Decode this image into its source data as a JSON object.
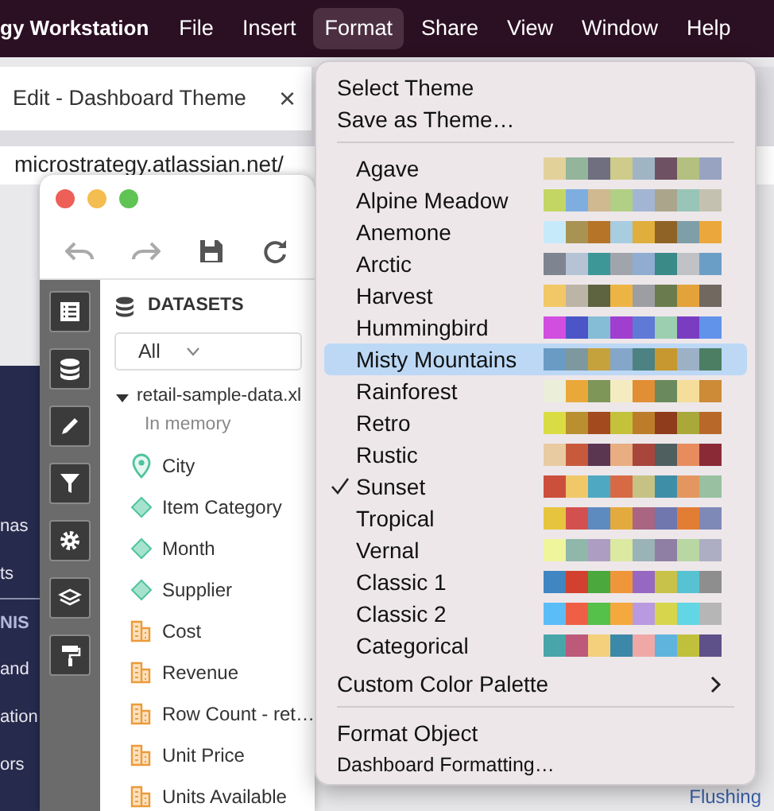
{
  "menubar": {
    "app_name": "gy Workstation",
    "items": [
      {
        "label": "File",
        "selected": false
      },
      {
        "label": "Insert",
        "selected": false
      },
      {
        "label": "Format",
        "selected": true
      },
      {
        "label": "Share",
        "selected": false
      },
      {
        "label": "View",
        "selected": false
      },
      {
        "label": "Window",
        "selected": false
      },
      {
        "label": "Help",
        "selected": false
      }
    ]
  },
  "browser": {
    "tab_title": "Edit - Dashboard Theme",
    "tab_close": "×",
    "url": "microstrategy.atlassian.net/",
    "side_fragments": [
      "nas",
      "ts",
      "NIS",
      "and",
      "ation",
      "ors"
    ],
    "corner_text": "Flushing"
  },
  "editor": {
    "datasets_title": "DATASETS",
    "filter": "All",
    "dataset": {
      "name": "retail-sample-data.xl",
      "expanded": true,
      "status": "In memory",
      "fields": [
        {
          "label": "City",
          "kind": "geo"
        },
        {
          "label": "Item Category",
          "kind": "attribute"
        },
        {
          "label": "Month",
          "kind": "attribute"
        },
        {
          "label": "Supplier",
          "kind": "attribute"
        },
        {
          "label": "Cost",
          "kind": "metric"
        },
        {
          "label": "Revenue",
          "kind": "metric"
        },
        {
          "label": "Row Count - ret…",
          "kind": "metric"
        },
        {
          "label": "Unit Price",
          "kind": "metric"
        },
        {
          "label": "Units Available",
          "kind": "metric"
        }
      ]
    }
  },
  "format_menu": {
    "top_items": [
      "Select Theme",
      "Save as Theme…"
    ],
    "themes": [
      {
        "label": "Agave",
        "checked": false,
        "selected": false,
        "swatches": [
          {
            "color": "#e3d19a"
          },
          {
            "color": "#93b59b"
          },
          {
            "color": "#6f6f80"
          },
          {
            "color": "#cfcb8b"
          },
          {
            "color": "#9fb5c4"
          },
          {
            "color": "#6e5263"
          },
          {
            "color": "#b3c07f"
          },
          {
            "color": "#98a3c2"
          }
        ]
      },
      {
        "label": "Alpine Meadow",
        "checked": false,
        "selected": false,
        "swatches": [
          {
            "color": "#c3d664"
          },
          {
            "color": "#7eaee0"
          },
          {
            "color": "#d0b890"
          },
          {
            "color": "#b2cf86"
          },
          {
            "color": "#a2b5d2"
          },
          {
            "color": "#aba58c"
          },
          {
            "color": "#98c5b7"
          },
          {
            "color": "#c4c1b0"
          }
        ]
      },
      {
        "label": "Anemone",
        "checked": false,
        "selected": false,
        "swatches": [
          {
            "color": "#c6eafa"
          },
          {
            "color": "#a99353"
          },
          {
            "color": "#b57428"
          },
          {
            "color": "#a8cde0"
          },
          {
            "color": "#dfae3c"
          },
          {
            "color": "#8f6326"
          },
          {
            "color": "#7e9ea8"
          },
          {
            "color": "#eca73c"
          }
        ]
      },
      {
        "label": "Arctic",
        "checked": false,
        "selected": false,
        "swatches": [
          {
            "color": "#7e8591"
          },
          {
            "color": "#b5c3d5"
          },
          {
            "color": "#3e9797"
          },
          {
            "color": "#a0a5ac"
          },
          {
            "color": "#90acd0"
          },
          {
            "color": "#3a8a88"
          },
          {
            "color": "#c0c2c6"
          },
          {
            "color": "#6a9ec7"
          }
        ]
      },
      {
        "label": "Harvest",
        "checked": false,
        "selected": false,
        "swatches": [
          {
            "color": "#f2c866"
          },
          {
            "color": "#bcb5a7"
          },
          {
            "color": "#5e6340"
          },
          {
            "color": "#eeb443"
          },
          {
            "color": "#9c9ea2"
          },
          {
            "color": "#6a7c4d"
          },
          {
            "color": "#e3a23a"
          },
          {
            "color": "#716860"
          }
        ]
      },
      {
        "label": "Hummingbird",
        "checked": false,
        "selected": false,
        "swatches": [
          {
            "color": "#d24ede"
          },
          {
            "color": "#4c55c7"
          },
          {
            "color": "#86bdd6"
          },
          {
            "color": "#a03fcf"
          },
          {
            "color": "#5e7ad6"
          },
          {
            "color": "#9bcfb0"
          },
          {
            "color": "#7a3dc1"
          },
          {
            "color": "#6293ea"
          }
        ]
      },
      {
        "label": "Misty Mountains",
        "checked": false,
        "selected": true,
        "swatches": [
          {
            "color": "#6a9bc4"
          },
          {
            "color": "#7e98a0"
          },
          {
            "color": "#c6a23c"
          },
          {
            "color": "#84a6c8"
          },
          {
            "color": "#4c8282"
          },
          {
            "color": "#c6982f"
          },
          {
            "color": "#9cb0c6"
          },
          {
            "color": "#4b7e63"
          }
        ]
      },
      {
        "label": "Rainforest",
        "checked": false,
        "selected": false,
        "swatches": [
          {
            "color": "#ebeed8"
          },
          {
            "color": "#eaa83a"
          },
          {
            "color": "#7f9659"
          },
          {
            "color": "#f4ecc0"
          },
          {
            "color": "#e28e35"
          },
          {
            "color": "#6a8a5d"
          },
          {
            "color": "#f5dd9b"
          },
          {
            "color": "#cd8a37"
          }
        ]
      },
      {
        "label": "Retro",
        "checked": false,
        "selected": false,
        "swatches": [
          {
            "color": "#dadc44"
          },
          {
            "color": "#b98f2f"
          },
          {
            "color": "#a34a1e"
          },
          {
            "color": "#c4c23a"
          },
          {
            "color": "#bc7d2a"
          },
          {
            "color": "#8e3c1b"
          },
          {
            "color": "#a9a838"
          },
          {
            "color": "#b8692a"
          }
        ]
      },
      {
        "label": "Rustic",
        "checked": false,
        "selected": false,
        "swatches": [
          {
            "color": "#e8cba1"
          },
          {
            "color": "#c85a3c"
          },
          {
            "color": "#5a3651"
          },
          {
            "color": "#e8ad80"
          },
          {
            "color": "#a8463b"
          },
          {
            "color": "#4f5f60"
          },
          {
            "color": "#e88c5e"
          },
          {
            "color": "#8a2a37"
          }
        ]
      },
      {
        "label": "Sunset",
        "checked": true,
        "selected": false,
        "swatches": [
          {
            "color": "#cc4f3b"
          },
          {
            "color": "#f1c868"
          },
          {
            "color": "#4fa8c2"
          },
          {
            "color": "#d76a45"
          },
          {
            "color": "#c6c284"
          },
          {
            "color": "#3f8ea8"
          },
          {
            "color": "#e49660"
          },
          {
            "color": "#99c0a0"
          }
        ]
      },
      {
        "label": "Tropical",
        "checked": false,
        "selected": false,
        "swatches": [
          {
            "color": "#e6c43e"
          },
          {
            "color": "#d35050"
          },
          {
            "color": "#5d8bc0"
          },
          {
            "color": "#e3aa3e"
          },
          {
            "color": "#a96582"
          },
          {
            "color": "#6f77ae"
          },
          {
            "color": "#e37d34"
          },
          {
            "color": "#7f89b8"
          }
        ]
      },
      {
        "label": "Vernal",
        "checked": false,
        "selected": false,
        "swatches": [
          {
            "color": "#eef59c"
          },
          {
            "color": "#8fb8ab"
          },
          {
            "color": "#ad9dc3"
          },
          {
            "color": "#dbe9a1"
          },
          {
            "color": "#9ab3b7"
          },
          {
            "color": "#8f7fa4"
          },
          {
            "color": "#b8d7a2"
          },
          {
            "color": "#adaec4"
          }
        ]
      },
      {
        "label": "Classic 1",
        "checked": false,
        "selected": false,
        "swatches": [
          {
            "color": "#3f86c2"
          },
          {
            "color": "#d2402f"
          },
          {
            "color": "#4aa83c"
          },
          {
            "color": "#f0963a"
          },
          {
            "color": "#9668c2"
          },
          {
            "color": "#c9c24a"
          },
          {
            "color": "#56c2d2"
          },
          {
            "color": "#8e8e8e"
          }
        ]
      },
      {
        "label": "Classic 2",
        "checked": false,
        "selected": false,
        "swatches": [
          {
            "color": "#5bbdf5"
          },
          {
            "color": "#ef5f46"
          },
          {
            "color": "#55c04a"
          },
          {
            "color": "#f4a83e"
          },
          {
            "color": "#b99ae0"
          },
          {
            "color": "#d6d54c"
          },
          {
            "color": "#62d6e4"
          },
          {
            "color": "#b6b6b6"
          }
        ]
      },
      {
        "label": "Categorical",
        "checked": false,
        "selected": false,
        "swatches": [
          {
            "color": "#48a6a8"
          },
          {
            "color": "#bd5a7a"
          },
          {
            "color": "#f5d07c"
          },
          {
            "color": "#3c88a8"
          },
          {
            "color": "#efa8a6"
          },
          {
            "color": "#5fb4de"
          },
          {
            "color": "#c0c03c"
          },
          {
            "color": "#5e5088"
          }
        ]
      }
    ],
    "submenu_item": "Custom Color Palette",
    "bottom_items": [
      "Format Object",
      "Dashboard Formatting…"
    ]
  }
}
